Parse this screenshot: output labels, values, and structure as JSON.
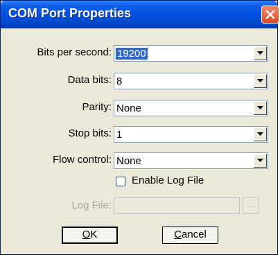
{
  "window": {
    "title": "COM Port Properties"
  },
  "fields": {
    "bits_per_second": {
      "label": "Bits per second:",
      "value": "19200"
    },
    "data_bits": {
      "label": "Data bits:",
      "value": "8"
    },
    "parity": {
      "label": "Parity:",
      "value": "None"
    },
    "stop_bits": {
      "label": "Stop bits:",
      "value": "1"
    },
    "flow_control": {
      "label": "Flow control:",
      "value": "None"
    }
  },
  "log": {
    "enable_label": "Enable Log File",
    "enabled": false,
    "file_label": "Log File:",
    "file_value": "",
    "browse_label": "..."
  },
  "buttons": {
    "ok_mnemonic": "O",
    "ok_rest": "K",
    "cancel_mnemonic": "C",
    "cancel_rest": "ancel"
  },
  "colors": {
    "title_bar": "#0052e0",
    "selection": "#316ac5",
    "close": "#d94b22"
  },
  "icons": {
    "close": "close-icon",
    "dropdown": "chevron-down-icon"
  }
}
